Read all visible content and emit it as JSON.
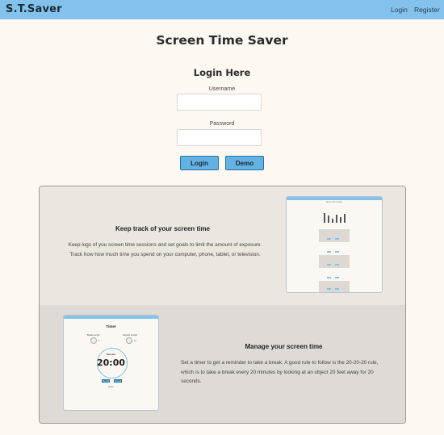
{
  "navbar": {
    "brand": "S.T.Saver",
    "links": {
      "login": "Login",
      "register": "Register"
    },
    "color": "#82c2ec"
  },
  "main": {
    "title": "Screen Time Saver",
    "login_heading": "Login Here",
    "username_label": "Username",
    "password_label": "Password",
    "username_value": "",
    "password_value": "",
    "login_button": "Login",
    "demo_button": "Demo"
  },
  "features": [
    {
      "title": "Keep track of your screen time",
      "text": "Keep logs of you screen time sessions and set goals to limit the amount of exposure. Track how how much time you spend on your computer, phone, tablet, or television."
    },
    {
      "title": "Manage your screen time",
      "text": "Set a timer to get a reminder to take a break. A good rule to follow is the 20-20-20 rule, which is to take a break every 20 minutes by looking at an object 20 feet away for 20 seconds."
    }
  ],
  "timer_preview": {
    "title": "Timer",
    "break_length_label": "Break Length",
    "session_length_label": "Session Length",
    "break_value": "5",
    "session_value": "20",
    "session_label": "Session",
    "time": "20:00",
    "start_label": "Start",
    "pause_label": "Pause",
    "reset_label": "Reset"
  },
  "colors": {
    "background": "#fef8f2",
    "accent": "#82c2ec",
    "button": "#63b2e4"
  }
}
